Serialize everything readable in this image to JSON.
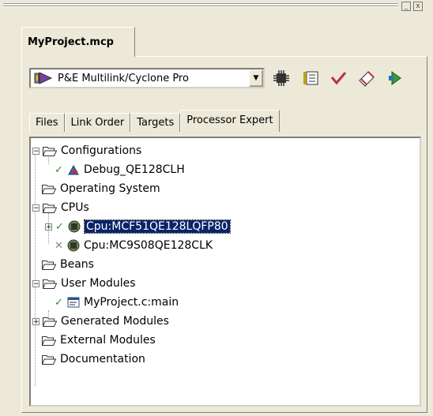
{
  "window": {
    "minimize_label": "_",
    "close_label": "x"
  },
  "project_tab": {
    "label": "MyProject.mcp"
  },
  "target_combo": {
    "value": "P&E Multilink/Cyclone Pro",
    "dropdown_arrow": "▼"
  },
  "toolbar": {
    "icons": [
      "chip-settings-icon",
      "make-icon",
      "check-icon",
      "debug-icon",
      "run-icon"
    ]
  },
  "tabs": [
    {
      "label": "Files",
      "active": false
    },
    {
      "label": "Link Order",
      "active": false
    },
    {
      "label": "Targets",
      "active": false
    },
    {
      "label": "Processor Expert",
      "active": true
    }
  ],
  "tree": {
    "nodes": [
      {
        "label": "Configurations",
        "expander": "−"
      },
      {
        "label": "Debug_QE128CLH"
      },
      {
        "label": "Operating System"
      },
      {
        "label": "CPUs",
        "expander": "−"
      },
      {
        "label": "Cpu:MCF51QE128LQFP80",
        "expander": "+"
      },
      {
        "label": "Cpu:MC9S08QE128CLK"
      },
      {
        "label": "Beans"
      },
      {
        "label": "User Modules",
        "expander": "−"
      },
      {
        "label": "MyProject.c:main"
      },
      {
        "label": "Generated Modules",
        "expander": "+"
      },
      {
        "label": "External Modules"
      },
      {
        "label": "Documentation"
      }
    ]
  },
  "colors": {
    "background": "#ece9d8",
    "selection": "#0a246a",
    "check_green": "#2e8b2e"
  }
}
